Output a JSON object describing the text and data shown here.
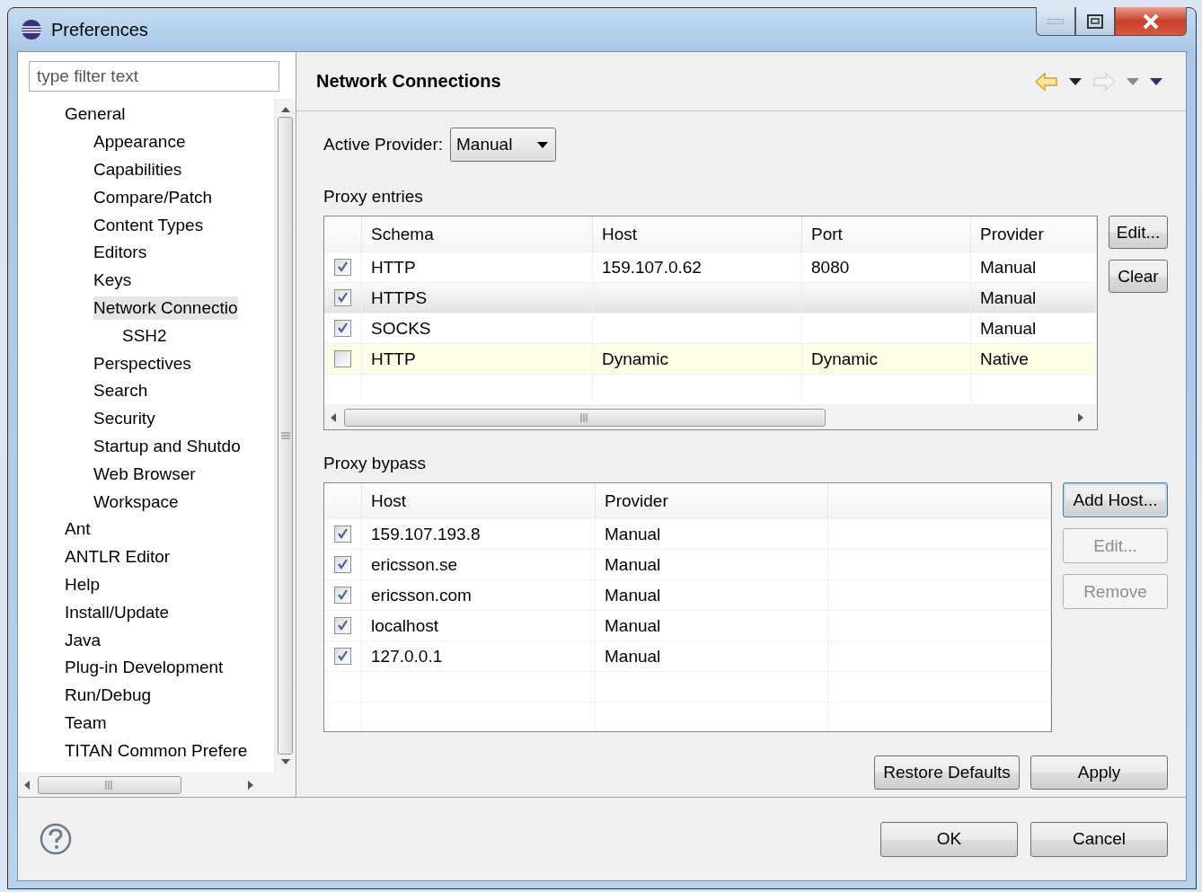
{
  "window": {
    "title": "Preferences"
  },
  "filter": {
    "placeholder": "type filter text"
  },
  "tree": [
    {
      "label": "General",
      "selected": false,
      "children": [
        {
          "label": "Appearance",
          "selected": false
        },
        {
          "label": "Capabilities",
          "selected": false
        },
        {
          "label": "Compare/Patch",
          "selected": false
        },
        {
          "label": "Content Types",
          "selected": false
        },
        {
          "label": "Editors",
          "selected": false
        },
        {
          "label": "Keys",
          "selected": false
        },
        {
          "label": "Network Connectio",
          "selected": true,
          "children": [
            {
              "label": "SSH2",
              "selected": false
            }
          ]
        },
        {
          "label": "Perspectives",
          "selected": false
        },
        {
          "label": "Search",
          "selected": false
        },
        {
          "label": "Security",
          "selected": false
        },
        {
          "label": "Startup and Shutdo",
          "selected": false
        },
        {
          "label": "Web Browser",
          "selected": false
        },
        {
          "label": "Workspace",
          "selected": false
        }
      ]
    },
    {
      "label": "Ant",
      "selected": false
    },
    {
      "label": "ANTLR Editor",
      "selected": false
    },
    {
      "label": "Help",
      "selected": false
    },
    {
      "label": "Install/Update",
      "selected": false
    },
    {
      "label": "Java",
      "selected": false
    },
    {
      "label": "Plug-in Development",
      "selected": false
    },
    {
      "label": "Run/Debug",
      "selected": false
    },
    {
      "label": "Team",
      "selected": false
    },
    {
      "label": "TITAN Common Prefere",
      "selected": false
    }
  ],
  "page": {
    "title": "Network Connections",
    "active_provider": {
      "label": "Active Provider:",
      "value": "Manual"
    }
  },
  "proxy_entries": {
    "label": "Proxy entries",
    "columns": [
      "Schema",
      "Host",
      "Port",
      "Provider"
    ],
    "rows": [
      {
        "checked": true,
        "selected": false,
        "native": false,
        "cells": [
          "HTTP",
          "159.107.0.62",
          "8080",
          "Manual"
        ]
      },
      {
        "checked": true,
        "selected": true,
        "native": false,
        "cells": [
          "HTTPS",
          "",
          "",
          "Manual"
        ]
      },
      {
        "checked": true,
        "selected": false,
        "native": false,
        "cells": [
          "SOCKS",
          "",
          "",
          "Manual"
        ]
      },
      {
        "checked": false,
        "selected": false,
        "native": true,
        "cells": [
          "HTTP",
          "Dynamic",
          "Dynamic",
          "Native"
        ]
      }
    ],
    "buttons": [
      {
        "label": "Edit...",
        "disabled": false,
        "focused": false
      },
      {
        "label": "Clear",
        "disabled": false,
        "focused": false
      }
    ]
  },
  "proxy_bypass": {
    "label": "Proxy bypass",
    "columns": [
      "Host",
      "Provider"
    ],
    "rows": [
      {
        "checked": true,
        "cells": [
          "159.107.193.8",
          "Manual"
        ]
      },
      {
        "checked": true,
        "cells": [
          "ericsson.se",
          "Manual"
        ]
      },
      {
        "checked": true,
        "cells": [
          "ericsson.com",
          "Manual"
        ]
      },
      {
        "checked": true,
        "cells": [
          "localhost",
          "Manual"
        ]
      },
      {
        "checked": true,
        "cells": [
          "127.0.0.1",
          "Manual"
        ]
      }
    ],
    "buttons": [
      {
        "label": "Add Host...",
        "disabled": false,
        "focused": true
      },
      {
        "label": "Edit...",
        "disabled": true,
        "focused": false
      },
      {
        "label": "Remove",
        "disabled": true,
        "focused": false
      }
    ]
  },
  "page_buttons": [
    "Restore Defaults",
    "Apply"
  ],
  "dialog_buttons": [
    "OK",
    "Cancel"
  ]
}
